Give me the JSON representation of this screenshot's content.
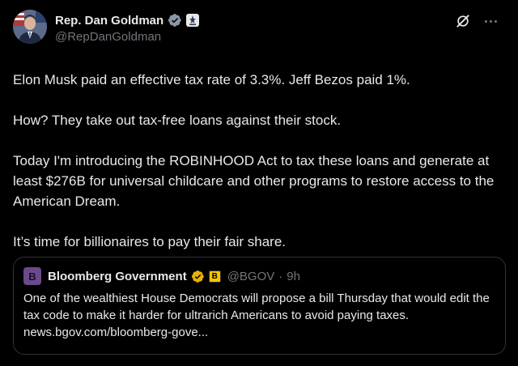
{
  "colors": {
    "background": "#000000",
    "text": "#e7e9ea",
    "muted": "#71767b",
    "verified_gold": "#e8b10a",
    "border": "#2f3336"
  },
  "author": {
    "name": "Rep. Dan Goldman",
    "handle": "@RepDanGoldman",
    "avatar_icon": "avatar-photo",
    "badges": [
      "gold-verified-icon",
      "government-badge-icon"
    ]
  },
  "actions": {
    "grok_icon": "grok-icon",
    "more_icon": "more-icon"
  },
  "body": {
    "p1": "Elon Musk paid an effective tax rate of 3.3%. Jeff Bezos paid 1%.",
    "p2": "How? They take out tax-free loans against their stock.",
    "p3": "Today I'm introducing the ROBINHOOD Act to tax these loans and generate at least $276B for universal childcare and other programs to restore access to the American Dream.",
    "p4": "It’s time for billionaires to pay their fair share."
  },
  "quote": {
    "avatar_letter": "B",
    "name": "Bloomberg Government",
    "badge_letter": "B",
    "handle": "@BGOV",
    "separator": "·",
    "time": "9h",
    "text": "One of the wealthiest House Democrats will propose a bill Thursday that would edit the tax code to make it harder for ultrarich Americans to avoid paying taxes. news.bgov.com/bloomberg-gove..."
  }
}
